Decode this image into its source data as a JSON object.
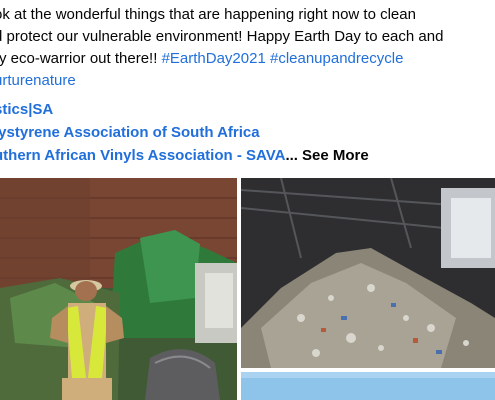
{
  "post": {
    "text_lines": [
      "ok at the wonderful things that are happening right now to clean",
      "d protect our vulnerable environment!  Happy Earth Day to each and",
      "ry eco-warrior out there!! "
    ],
    "hashtags": [
      "#EarthDay2021",
      "#cleanupandrecycle"
    ],
    "hashtag_line3": "urturenature",
    "mentions": [
      "stics|SA",
      "lystyrene Association of South Africa",
      "uthern African Vinyls Association - SAVA"
    ],
    "ellipsis": "...",
    "see_more": "See More"
  },
  "photos": [
    {
      "name": "recycling-worker-photo",
      "icon": "photo"
    },
    {
      "name": "waste-pile-photo",
      "icon": "photo"
    },
    {
      "name": "sky-photo",
      "icon": "photo"
    }
  ]
}
